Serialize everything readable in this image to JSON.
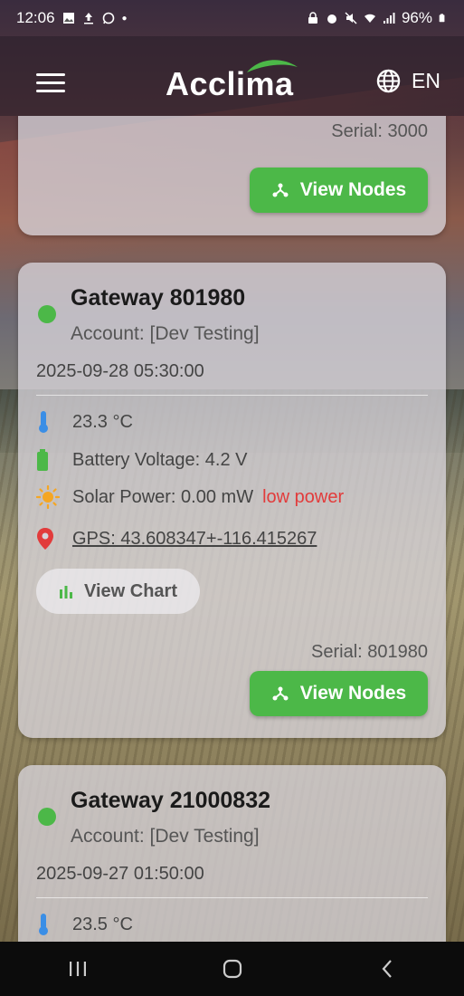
{
  "status_bar": {
    "time": "12:06",
    "battery": "96%"
  },
  "header": {
    "logo_text": "Acclima",
    "language": "EN"
  },
  "cards": [
    {
      "serial": "Serial: 3000",
      "view_nodes_label": "View Nodes"
    },
    {
      "title": "Gateway 801980",
      "account": "Account: [Dev Testing]",
      "datetime": "2025-09-28 05:30:00",
      "temperature": "23.3 °C",
      "battery": "Battery Voltage: 4.2 V",
      "solar": "Solar Power: 0.00 mW",
      "solar_warning": "low power",
      "gps": "GPS: 43.608347+-116.415267",
      "view_chart_label": "View Chart",
      "serial": "Serial: 801980",
      "view_nodes_label": "View Nodes"
    },
    {
      "title": "Gateway 21000832",
      "account": "Account: [Dev Testing]",
      "datetime": "2025-09-27 01:50:00",
      "temperature": "23.5 °C"
    }
  ],
  "colors": {
    "accent_green": "#4cb848",
    "warning_red": "#e23b3b",
    "thermo_blue": "#3a8ee6",
    "sun_orange": "#f5a623"
  }
}
